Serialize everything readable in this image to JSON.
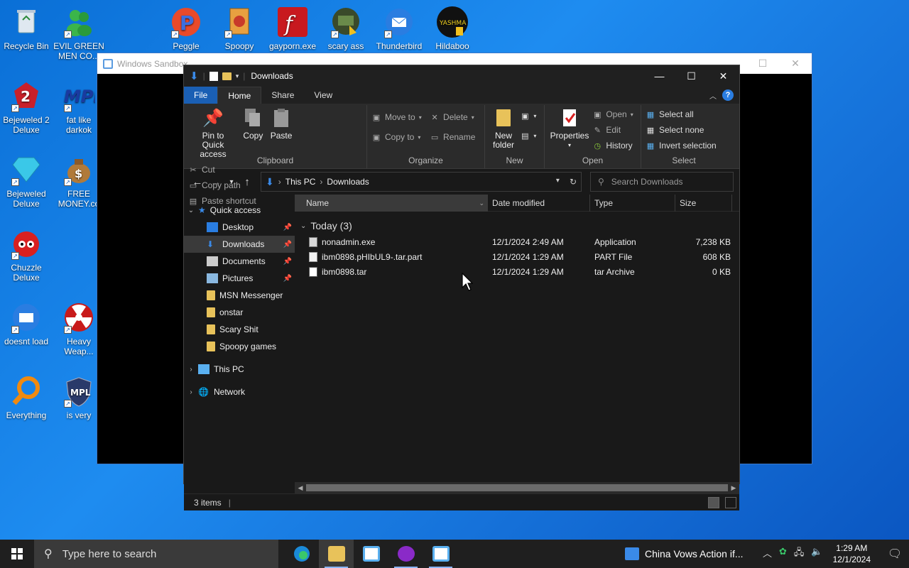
{
  "desktop": {
    "icons": [
      {
        "label": "Recycle Bin"
      },
      {
        "label": "EVIL GREEN MEN CO..."
      },
      {
        "label": "Peggle"
      },
      {
        "label": "Spoopy"
      },
      {
        "label": "gayporn.exe"
      },
      {
        "label": "scary ass"
      },
      {
        "label": "Thunderbird"
      },
      {
        "label": "Hildaboo"
      },
      {
        "label": "Bejeweled 2 Deluxe"
      },
      {
        "label": "fat like darkok"
      },
      {
        "label": "Bejeweled Deluxe"
      },
      {
        "label": "FREE MONEY.co"
      },
      {
        "label": "Chuzzle Deluxe"
      },
      {
        "label": "doesnt load"
      },
      {
        "label": "Heavy Weap..."
      },
      {
        "label": "Everything"
      },
      {
        "label": "is very"
      }
    ],
    "hildaboo_text": "YASHMA"
  },
  "sandbox": {
    "title": "Windows Sandbox",
    "minimize": "—",
    "maximize": "☐",
    "close": "✕"
  },
  "explorer": {
    "title": "Downloads",
    "minimize": "—",
    "maximize": "☐",
    "close": "✕",
    "tabs": {
      "file": "File",
      "home": "Home",
      "share": "Share",
      "view": "View"
    },
    "help": "?",
    "ribbon": {
      "clipboard": {
        "label": "Clipboard",
        "pin": "Pin to Quick access",
        "copy": "Copy",
        "paste": "Paste",
        "cut": "Cut",
        "copy_path": "Copy path",
        "paste_shortcut": "Paste shortcut"
      },
      "organize": {
        "label": "Organize",
        "move_to": "Move to",
        "copy_to": "Copy to",
        "delete": "Delete",
        "rename": "Rename"
      },
      "new": {
        "label": "New",
        "new_folder": "New folder"
      },
      "open": {
        "label": "Open",
        "properties": "Properties",
        "open": "Open",
        "edit": "Edit",
        "history": "History"
      },
      "select": {
        "label": "Select",
        "select_all": "Select all",
        "select_none": "Select none",
        "invert": "Invert selection"
      }
    },
    "address": {
      "root": "This PC",
      "current": "Downloads"
    },
    "search": {
      "placeholder": "Search Downloads"
    },
    "nav": {
      "quick_access": "Quick access",
      "items": [
        {
          "label": "Desktop",
          "pinned": true
        },
        {
          "label": "Downloads",
          "pinned": true,
          "selected": true
        },
        {
          "label": "Documents",
          "pinned": true
        },
        {
          "label": "Pictures",
          "pinned": true
        },
        {
          "label": "MSN Messenger"
        },
        {
          "label": "onstar"
        },
        {
          "label": "Scary Shit"
        },
        {
          "label": "Spoopy games"
        }
      ],
      "this_pc": "This PC",
      "network": "Network"
    },
    "columns": {
      "name": "Name",
      "date": "Date modified",
      "type": "Type",
      "size": "Size"
    },
    "group": "Today (3)",
    "files": [
      {
        "name": "nonadmin.exe",
        "date": "12/1/2024 2:49 AM",
        "type": "Application",
        "size": "7,238 KB"
      },
      {
        "name": "ibm0898.pHIbUL9-.tar.part",
        "date": "12/1/2024 1:29 AM",
        "type": "PART File",
        "size": "608 KB"
      },
      {
        "name": "ibm0898.tar",
        "date": "12/1/2024 1:29 AM",
        "type": "tar Archive",
        "size": "0 KB"
      }
    ],
    "status": "3 items"
  },
  "taskbar": {
    "search_placeholder": "Type here to search",
    "news": "China Vows Action if...",
    "time": "1:29 AM",
    "date": "12/1/2024"
  }
}
